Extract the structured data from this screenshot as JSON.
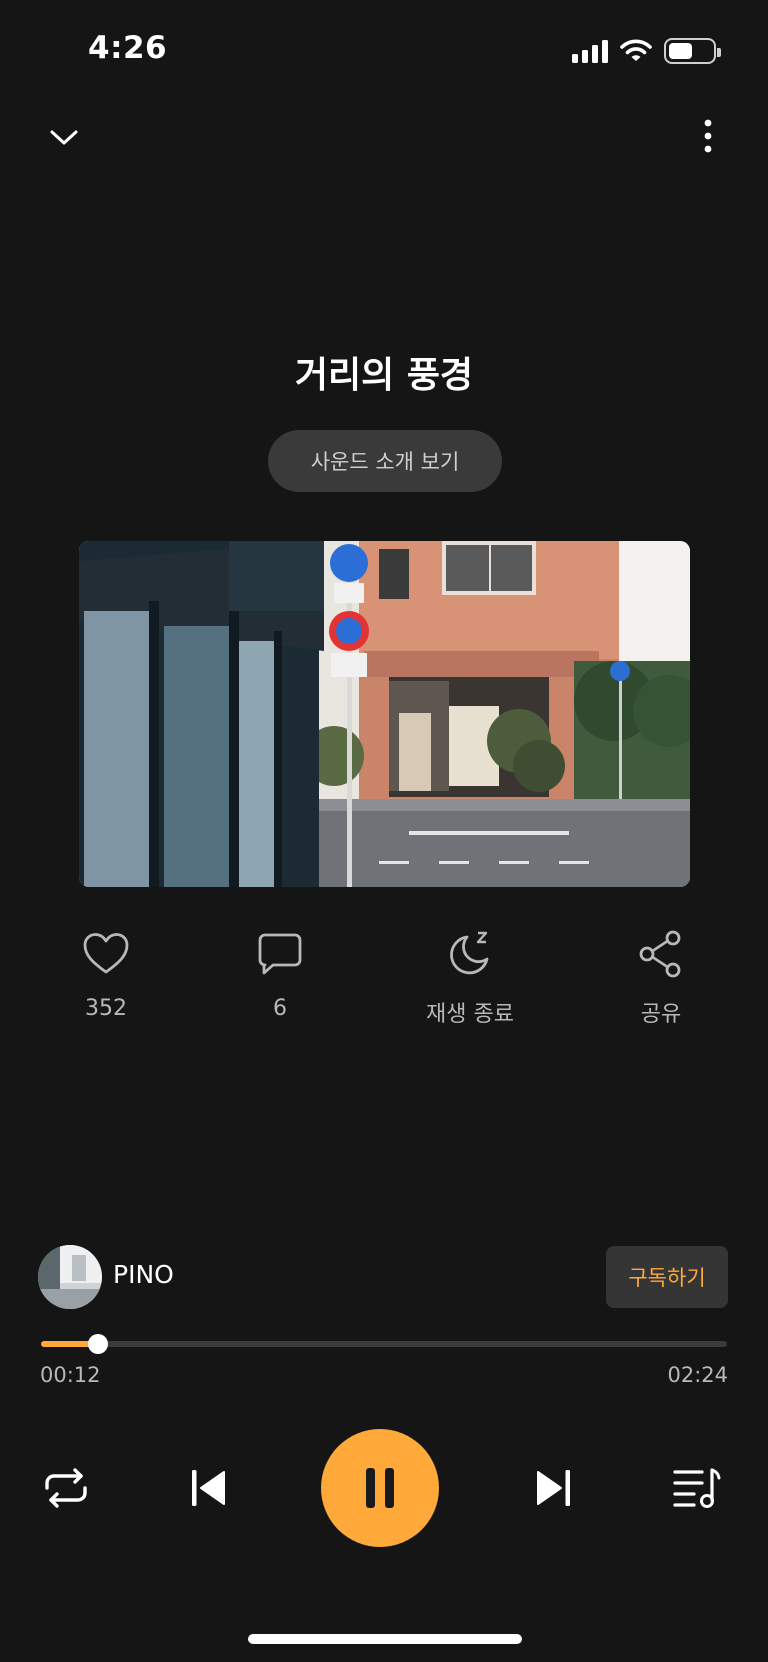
{
  "status_bar": {
    "time": "4:26",
    "battery_level": 0.6
  },
  "nav": {
    "collapse_icon": "chevron-down-icon",
    "more_icon": "more-vertical-icon"
  },
  "track": {
    "title": "거리의 풍경",
    "intro_button": "사운드 소개 보기"
  },
  "actions": {
    "like": {
      "icon": "heart-icon",
      "label": "352"
    },
    "comment": {
      "icon": "comment-icon",
      "label": "6"
    },
    "sleep": {
      "icon": "moon-sleep-icon",
      "label": "재생 종료"
    },
    "share": {
      "icon": "share-icon",
      "label": "공유"
    }
  },
  "artist": {
    "name": "PINO",
    "subscribe_label": "구독하기"
  },
  "player": {
    "current_time": "00:12",
    "total_time": "02:24",
    "progress": 0.083,
    "repeat_icon": "repeat-icon",
    "prev_icon": "skip-previous-icon",
    "pause_icon": "pause-icon",
    "next_icon": "skip-next-icon",
    "playlist_icon": "playlist-icon"
  },
  "colors": {
    "background": "#151515",
    "accent": "#ffa93a",
    "muted_text": "#b8b8b8"
  }
}
